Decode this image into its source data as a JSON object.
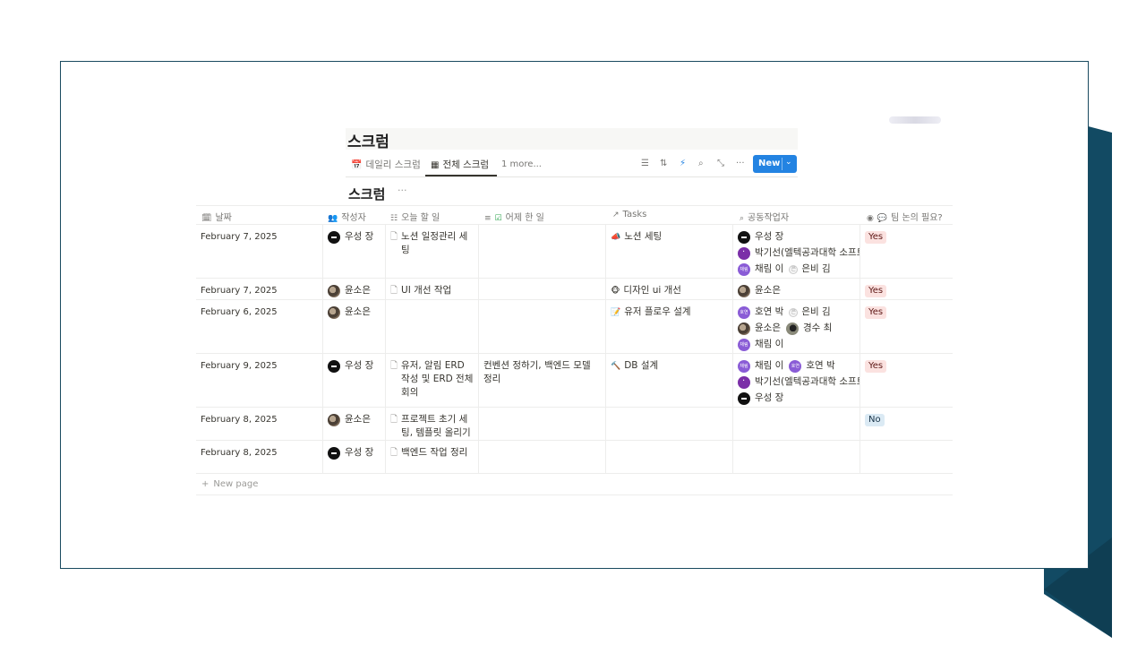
{
  "database": {
    "title": "스크럼",
    "tabs": [
      {
        "label": "데일리 스크럼",
        "icon": "calendar-icon"
      },
      {
        "label": "전체 스크럼",
        "icon": "table-icon"
      }
    ],
    "more_tabs": "1 more...",
    "new_button": "New",
    "view_title": "스크럼",
    "view_menu": "···"
  },
  "columns": [
    {
      "label": "날짜",
      "icon": "calendar-icon"
    },
    {
      "label": "작성자",
      "icon": "people-icon"
    },
    {
      "label": "오늘 할 일",
      "icon": "checklist-icon"
    },
    {
      "label": "어제 한 일",
      "icon": "text-icon"
    },
    {
      "label": "Tasks",
      "icon": "arrow-relation-icon"
    },
    {
      "label": "공동작업자",
      "icon": "search-icon"
    },
    {
      "label": "팀 논의 필요?",
      "icon": "select-icon"
    }
  ],
  "rows": [
    {
      "date": "February 7, 2025",
      "author": "우성 장",
      "today": "노션 일정관리 세팅",
      "yesterday": "",
      "task": "노션 세팅",
      "collab": [
        "우성 장",
        "박기선(엘텍공과대학 소프트웨어학부)",
        "채림 이",
        "은비 김"
      ],
      "discuss": "Yes"
    },
    {
      "date": "February 7, 2025",
      "author": "윤소은",
      "today": "UI 개선 작업",
      "yesterday": "",
      "task": "디자인 ui 개선",
      "collab": [
        "윤소은"
      ],
      "discuss": "Yes"
    },
    {
      "date": "February 6, 2025",
      "author": "윤소은",
      "today": "",
      "yesterday": "",
      "task": "유저 플로우 설계",
      "collab": [
        "호연 박",
        "은비 김",
        "윤소은",
        "경수 최",
        "채림 이"
      ],
      "discuss": "Yes"
    },
    {
      "date": "February 9, 2025",
      "author": "우성 장",
      "today": "유저, 알림 ERD 작성 및 ERD 전체 회의",
      "yesterday": "컨벤션 정하기, 백엔드 모델 정리",
      "task": "DB 설계",
      "collab": [
        "채림 이",
        "호연 박",
        "박기선(엘텍공과대학 소프트웨어학부)",
        "우성 장"
      ],
      "discuss": "Yes"
    },
    {
      "date": "February 8, 2025",
      "author": "윤소은",
      "today": "프로젝트 초기 세팅, 템플릿 올리기",
      "yesterday": "",
      "task": "",
      "collab": [],
      "discuss": "No"
    },
    {
      "date": "February 8, 2025",
      "author": "우성 장",
      "today": "백엔드 작업 정리",
      "yesterday": "",
      "task": "",
      "collab": [],
      "discuss": ""
    }
  ],
  "new_page": "New page",
  "colors": {
    "accent": "#2383e2",
    "slide_border": "#1a4a5f",
    "decor": "#124a63",
    "yes_bg": "#fbe2e0",
    "no_bg": "#dbeaf4"
  }
}
